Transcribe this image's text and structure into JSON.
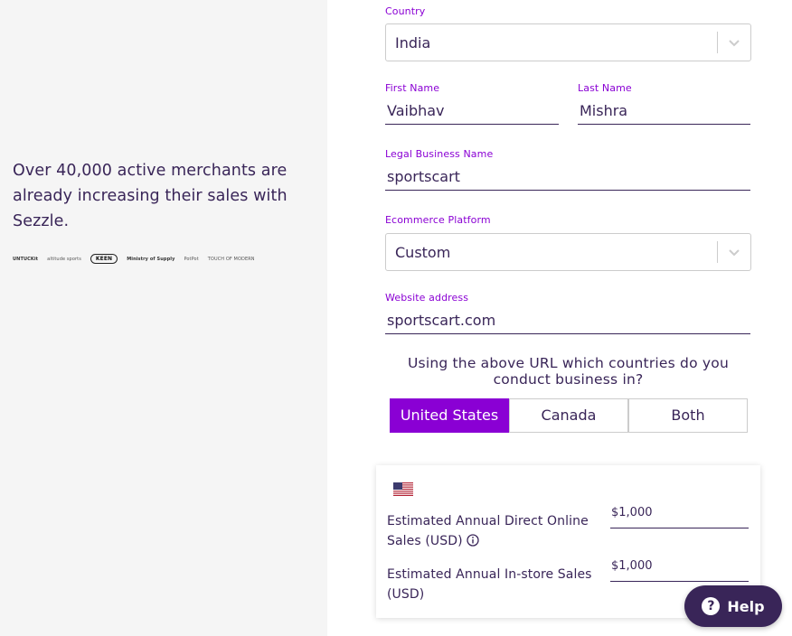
{
  "left": {
    "tagline": "Over 40,000 active merchants are already increasing their sales with Sezzle.",
    "logos": [
      "UNTUCKit",
      "altitude sports",
      "KEEN",
      "Ministry of Supply",
      "PotPot",
      "TOUCH OF MODERN"
    ]
  },
  "form": {
    "country": {
      "label": "Country",
      "value": "India"
    },
    "first_name": {
      "label": "First Name",
      "value": "Vaibhav"
    },
    "last_name": {
      "label": "Last Name",
      "value": "Mishra"
    },
    "business_name": {
      "label": "Legal Business Name",
      "value": "sportscart"
    },
    "platform": {
      "label": "Ecommerce Platform",
      "value": "Custom"
    },
    "website": {
      "label": "Website address",
      "value": "sportscart.com"
    },
    "countries_question": "Using the above URL which countries do you conduct business in?",
    "country_options": [
      "United States",
      "Canada",
      "Both"
    ],
    "selected_country_option": "United States"
  },
  "sales": {
    "flag_icon": "us-flag-icon",
    "online_label": "Estimated Annual Direct Online Sales (USD)",
    "online_value": "$1,000",
    "instore_label": "Estimated Annual In-store Sales (USD)",
    "instore_value": "$1,000"
  },
  "help": {
    "label": "Help",
    "icon": "question-circle-icon"
  },
  "colors": {
    "accent": "#8a00d4",
    "text": "#392558",
    "panel": "#f5f5f5"
  }
}
